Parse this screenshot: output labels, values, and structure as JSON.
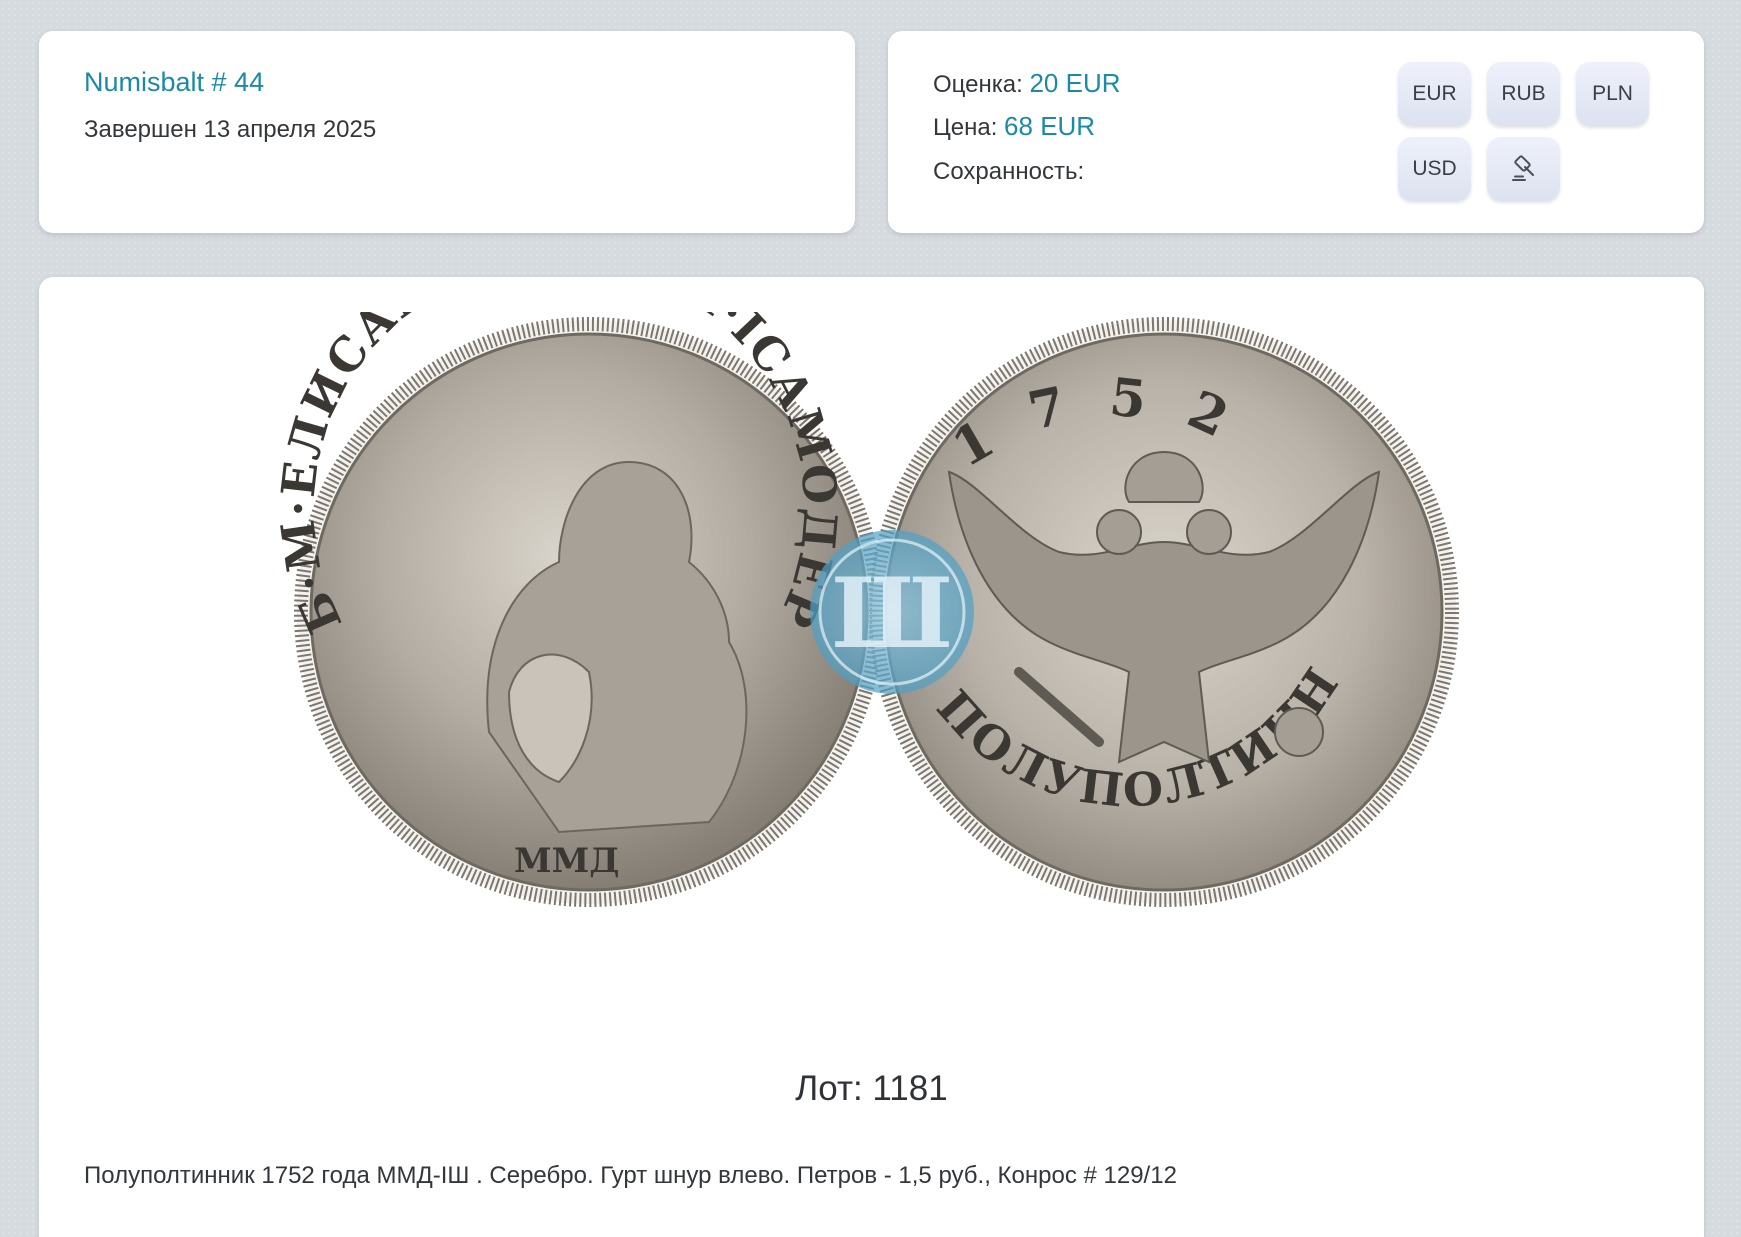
{
  "auction": {
    "name": "Numisbalt # 44",
    "status": "Завершен 13 апреля 2025"
  },
  "pricing": {
    "estimate_label": "Оценка:",
    "estimate_value": "20 EUR",
    "price_label": "Цена:",
    "price_value": "68 EUR",
    "condition_label": "Сохранность:",
    "condition_value": ""
  },
  "currency_buttons": [
    "EUR",
    "RUB",
    "PLN",
    "USD"
  ],
  "icons": {
    "auction": "gavel-icon"
  },
  "coin": {
    "obverse_legend": "Б·М·ЕЛИСАВЕТЪ·I·IМП·IСАМОДЕРЖ",
    "obverse_mint": "ММД",
    "reverse_year": "1752",
    "reverse_legend": "ПОЛУПОЛТИННИКЪ",
    "watermark": "Ш"
  },
  "lot": {
    "number_label": "Лот: 1181",
    "description": "Полуполтинник 1752 года ММД-IШ . Серебро. Гурт шнур влево. Петров - 1,5 руб., Конрос # 129/12"
  },
  "colors": {
    "accent": "#1b8aa6",
    "background": "#d6dbe0",
    "card": "#ffffff"
  }
}
